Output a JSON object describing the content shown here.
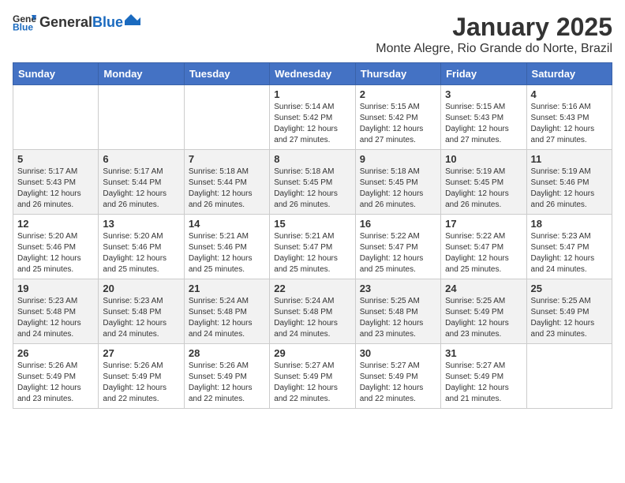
{
  "logo": {
    "general": "General",
    "blue": "Blue"
  },
  "header": {
    "title": "January 2025",
    "subtitle": "Monte Alegre, Rio Grande do Norte, Brazil"
  },
  "weekdays": [
    "Sunday",
    "Monday",
    "Tuesday",
    "Wednesday",
    "Thursday",
    "Friday",
    "Saturday"
  ],
  "weeks": [
    [
      {
        "day": "",
        "sunrise": "",
        "sunset": "",
        "daylight": ""
      },
      {
        "day": "",
        "sunrise": "",
        "sunset": "",
        "daylight": ""
      },
      {
        "day": "",
        "sunrise": "",
        "sunset": "",
        "daylight": ""
      },
      {
        "day": "1",
        "sunrise": "Sunrise: 5:14 AM",
        "sunset": "Sunset: 5:42 PM",
        "daylight": "Daylight: 12 hours and 27 minutes."
      },
      {
        "day": "2",
        "sunrise": "Sunrise: 5:15 AM",
        "sunset": "Sunset: 5:42 PM",
        "daylight": "Daylight: 12 hours and 27 minutes."
      },
      {
        "day": "3",
        "sunrise": "Sunrise: 5:15 AM",
        "sunset": "Sunset: 5:43 PM",
        "daylight": "Daylight: 12 hours and 27 minutes."
      },
      {
        "day": "4",
        "sunrise": "Sunrise: 5:16 AM",
        "sunset": "Sunset: 5:43 PM",
        "daylight": "Daylight: 12 hours and 27 minutes."
      }
    ],
    [
      {
        "day": "5",
        "sunrise": "Sunrise: 5:17 AM",
        "sunset": "Sunset: 5:43 PM",
        "daylight": "Daylight: 12 hours and 26 minutes."
      },
      {
        "day": "6",
        "sunrise": "Sunrise: 5:17 AM",
        "sunset": "Sunset: 5:44 PM",
        "daylight": "Daylight: 12 hours and 26 minutes."
      },
      {
        "day": "7",
        "sunrise": "Sunrise: 5:18 AM",
        "sunset": "Sunset: 5:44 PM",
        "daylight": "Daylight: 12 hours and 26 minutes."
      },
      {
        "day": "8",
        "sunrise": "Sunrise: 5:18 AM",
        "sunset": "Sunset: 5:45 PM",
        "daylight": "Daylight: 12 hours and 26 minutes."
      },
      {
        "day": "9",
        "sunrise": "Sunrise: 5:18 AM",
        "sunset": "Sunset: 5:45 PM",
        "daylight": "Daylight: 12 hours and 26 minutes."
      },
      {
        "day": "10",
        "sunrise": "Sunrise: 5:19 AM",
        "sunset": "Sunset: 5:45 PM",
        "daylight": "Daylight: 12 hours and 26 minutes."
      },
      {
        "day": "11",
        "sunrise": "Sunrise: 5:19 AM",
        "sunset": "Sunset: 5:46 PM",
        "daylight": "Daylight: 12 hours and 26 minutes."
      }
    ],
    [
      {
        "day": "12",
        "sunrise": "Sunrise: 5:20 AM",
        "sunset": "Sunset: 5:46 PM",
        "daylight": "Daylight: 12 hours and 25 minutes."
      },
      {
        "day": "13",
        "sunrise": "Sunrise: 5:20 AM",
        "sunset": "Sunset: 5:46 PM",
        "daylight": "Daylight: 12 hours and 25 minutes."
      },
      {
        "day": "14",
        "sunrise": "Sunrise: 5:21 AM",
        "sunset": "Sunset: 5:46 PM",
        "daylight": "Daylight: 12 hours and 25 minutes."
      },
      {
        "day": "15",
        "sunrise": "Sunrise: 5:21 AM",
        "sunset": "Sunset: 5:47 PM",
        "daylight": "Daylight: 12 hours and 25 minutes."
      },
      {
        "day": "16",
        "sunrise": "Sunrise: 5:22 AM",
        "sunset": "Sunset: 5:47 PM",
        "daylight": "Daylight: 12 hours and 25 minutes."
      },
      {
        "day": "17",
        "sunrise": "Sunrise: 5:22 AM",
        "sunset": "Sunset: 5:47 PM",
        "daylight": "Daylight: 12 hours and 25 minutes."
      },
      {
        "day": "18",
        "sunrise": "Sunrise: 5:23 AM",
        "sunset": "Sunset: 5:47 PM",
        "daylight": "Daylight: 12 hours and 24 minutes."
      }
    ],
    [
      {
        "day": "19",
        "sunrise": "Sunrise: 5:23 AM",
        "sunset": "Sunset: 5:48 PM",
        "daylight": "Daylight: 12 hours and 24 minutes."
      },
      {
        "day": "20",
        "sunrise": "Sunrise: 5:23 AM",
        "sunset": "Sunset: 5:48 PM",
        "daylight": "Daylight: 12 hours and 24 minutes."
      },
      {
        "day": "21",
        "sunrise": "Sunrise: 5:24 AM",
        "sunset": "Sunset: 5:48 PM",
        "daylight": "Daylight: 12 hours and 24 minutes."
      },
      {
        "day": "22",
        "sunrise": "Sunrise: 5:24 AM",
        "sunset": "Sunset: 5:48 PM",
        "daylight": "Daylight: 12 hours and 24 minutes."
      },
      {
        "day": "23",
        "sunrise": "Sunrise: 5:25 AM",
        "sunset": "Sunset: 5:48 PM",
        "daylight": "Daylight: 12 hours and 23 minutes."
      },
      {
        "day": "24",
        "sunrise": "Sunrise: 5:25 AM",
        "sunset": "Sunset: 5:49 PM",
        "daylight": "Daylight: 12 hours and 23 minutes."
      },
      {
        "day": "25",
        "sunrise": "Sunrise: 5:25 AM",
        "sunset": "Sunset: 5:49 PM",
        "daylight": "Daylight: 12 hours and 23 minutes."
      }
    ],
    [
      {
        "day": "26",
        "sunrise": "Sunrise: 5:26 AM",
        "sunset": "Sunset: 5:49 PM",
        "daylight": "Daylight: 12 hours and 23 minutes."
      },
      {
        "day": "27",
        "sunrise": "Sunrise: 5:26 AM",
        "sunset": "Sunset: 5:49 PM",
        "daylight": "Daylight: 12 hours and 22 minutes."
      },
      {
        "day": "28",
        "sunrise": "Sunrise: 5:26 AM",
        "sunset": "Sunset: 5:49 PM",
        "daylight": "Daylight: 12 hours and 22 minutes."
      },
      {
        "day": "29",
        "sunrise": "Sunrise: 5:27 AM",
        "sunset": "Sunset: 5:49 PM",
        "daylight": "Daylight: 12 hours and 22 minutes."
      },
      {
        "day": "30",
        "sunrise": "Sunrise: 5:27 AM",
        "sunset": "Sunset: 5:49 PM",
        "daylight": "Daylight: 12 hours and 22 minutes."
      },
      {
        "day": "31",
        "sunrise": "Sunrise: 5:27 AM",
        "sunset": "Sunset: 5:49 PM",
        "daylight": "Daylight: 12 hours and 21 minutes."
      },
      {
        "day": "",
        "sunrise": "",
        "sunset": "",
        "daylight": ""
      }
    ]
  ]
}
